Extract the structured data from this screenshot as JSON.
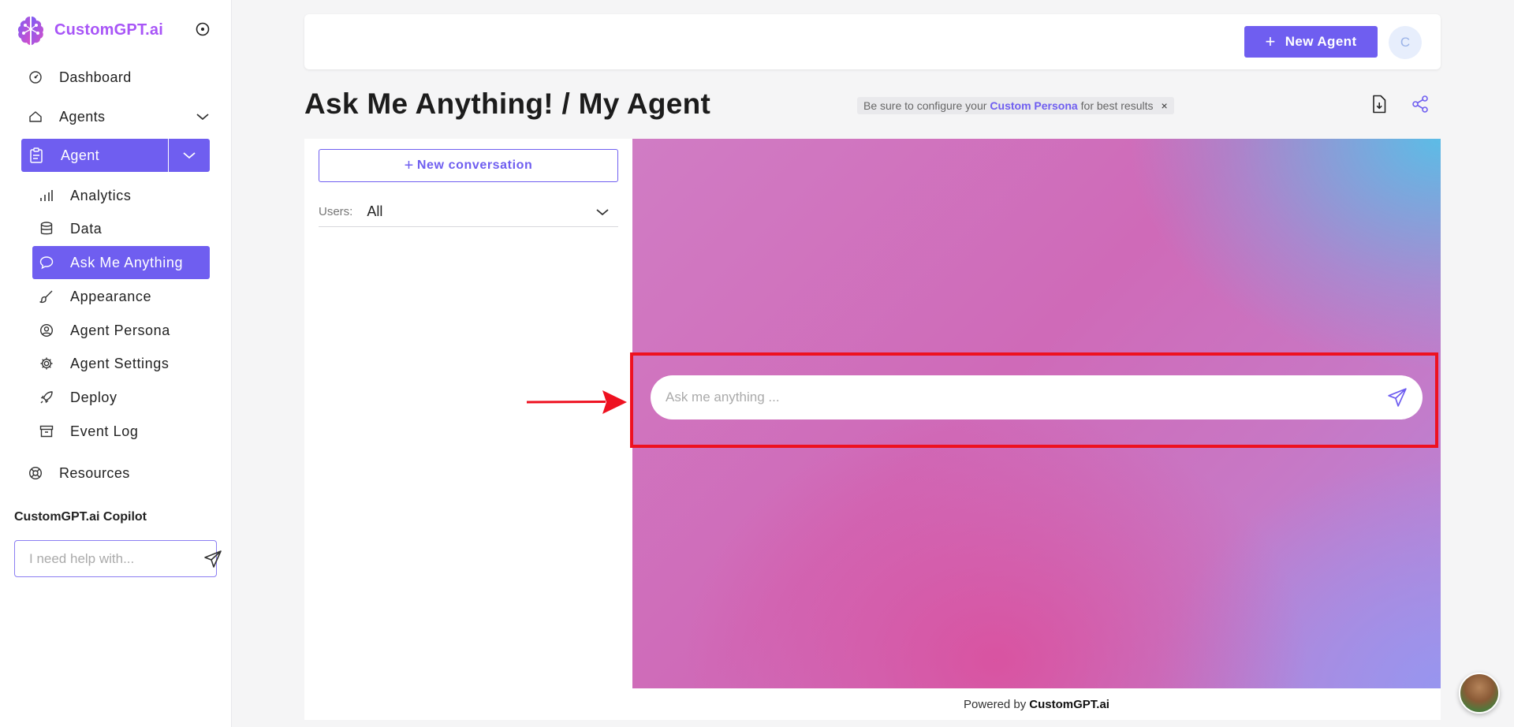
{
  "brand": {
    "name": "CustomGPT.ai"
  },
  "sidebar": {
    "items": [
      {
        "label": "Dashboard"
      },
      {
        "label": "Agents"
      },
      {
        "label": "Agent"
      },
      {
        "label": "Resources"
      }
    ],
    "agent_sub": [
      {
        "label": "Analytics"
      },
      {
        "label": "Data"
      },
      {
        "label": "Ask Me Anything"
      },
      {
        "label": "Appearance"
      },
      {
        "label": "Agent Persona"
      },
      {
        "label": "Agent Settings"
      },
      {
        "label": "Deploy"
      },
      {
        "label": "Event Log"
      }
    ],
    "copilot": {
      "title": "CustomGPT.ai Copilot",
      "placeholder": "I need help with..."
    }
  },
  "topbar": {
    "new_agent_label": "New Agent",
    "avatar_initial": "C"
  },
  "header": {
    "title": "Ask Me Anything! / My Agent",
    "hint_prefix": "Be sure to configure your",
    "hint_link": "Custom Persona",
    "hint_suffix": "for best results",
    "hint_close": "×"
  },
  "conversations": {
    "new_label": "New conversation",
    "users_label": "Users:",
    "users_value": "All"
  },
  "chat": {
    "placeholder": "Ask me anything ...",
    "footer_prefix": "Powered by",
    "footer_brand": "CustomGPT.ai"
  },
  "colors": {
    "accent": "#6f5ef0",
    "highlight": "#ee1120",
    "brand": "#a855f7"
  }
}
